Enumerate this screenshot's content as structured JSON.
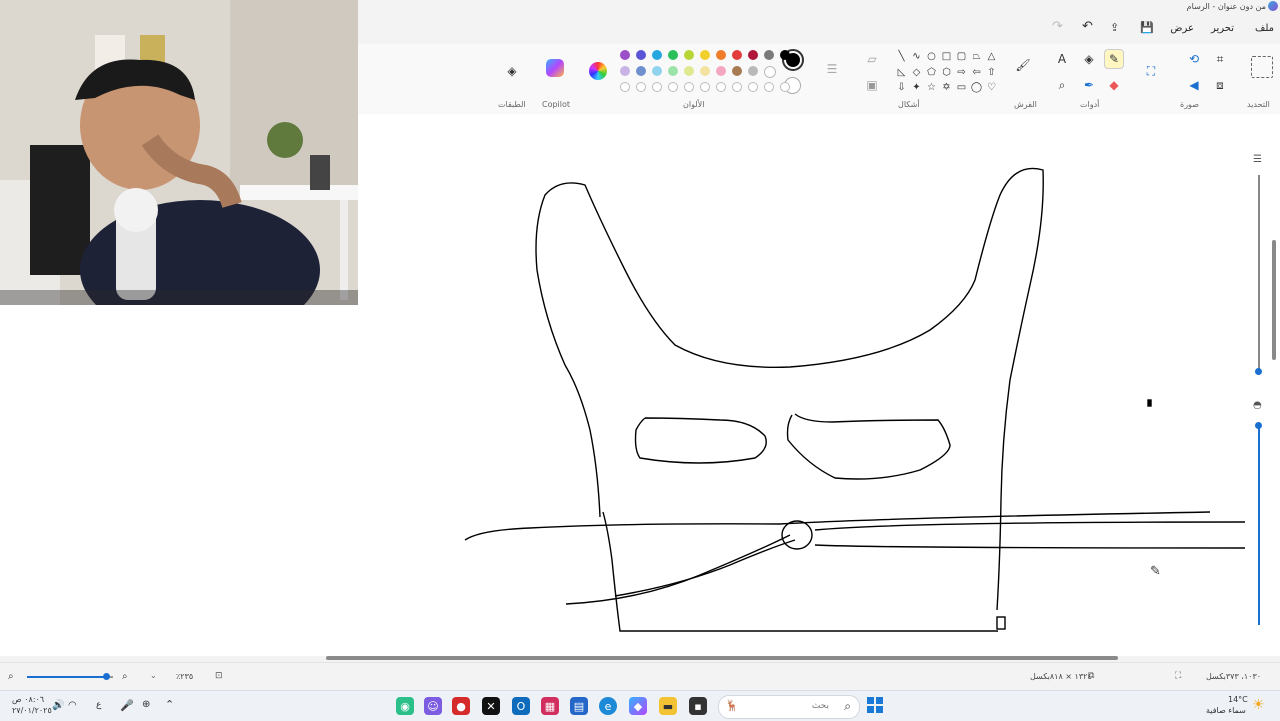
{
  "window": {
    "title": "من دون عنوان - الرسام"
  },
  "menu": {
    "file": "ملف",
    "edit": "تحرير",
    "view": "عرض"
  },
  "ribbon": {
    "groups": {
      "selection": "التحديد",
      "image": "صورة",
      "tools": "أدوات",
      "brushes": "الفرش",
      "shapes": "أشكال",
      "colors": "الألوان",
      "copilot": "Copilot",
      "layers": "الطبقات"
    },
    "colors_row1": [
      "#9b4fc8",
      "#5a55d6",
      "#26a7e0",
      "#2bbf5a",
      "#b7d636",
      "#f2d02c",
      "#f07d2a",
      "#e23b3b",
      "#b0163a",
      "#7a7a7a",
      "#000000"
    ],
    "colors_row2": [
      "#c7b4e4",
      "#6f8fcf",
      "#8fd3ef",
      "#9be3a8",
      "#dfe98f",
      "#f3e3a0",
      "#f5a6c2",
      "#a77a52",
      "#b9b9b9",
      "#ffffff"
    ],
    "primary_color": "#000000",
    "secondary_color": "#ffffff"
  },
  "status": {
    "zoom_percent": "٪٢٣٥",
    "canvas_size": "١٣٢٤ × ٨١٨بكسل",
    "cursor_position": "١٠٣٠، ٣٧٣بكسل",
    "zoom_level": 0.92
  },
  "taskbar": {
    "search_placeholder": "بحث",
    "time": "٠٨:٠٦ ص",
    "date": "٢٧/٠١/٢٠٢٥",
    "weather_temp": "14°C",
    "weather_text": "سماء صافية"
  }
}
